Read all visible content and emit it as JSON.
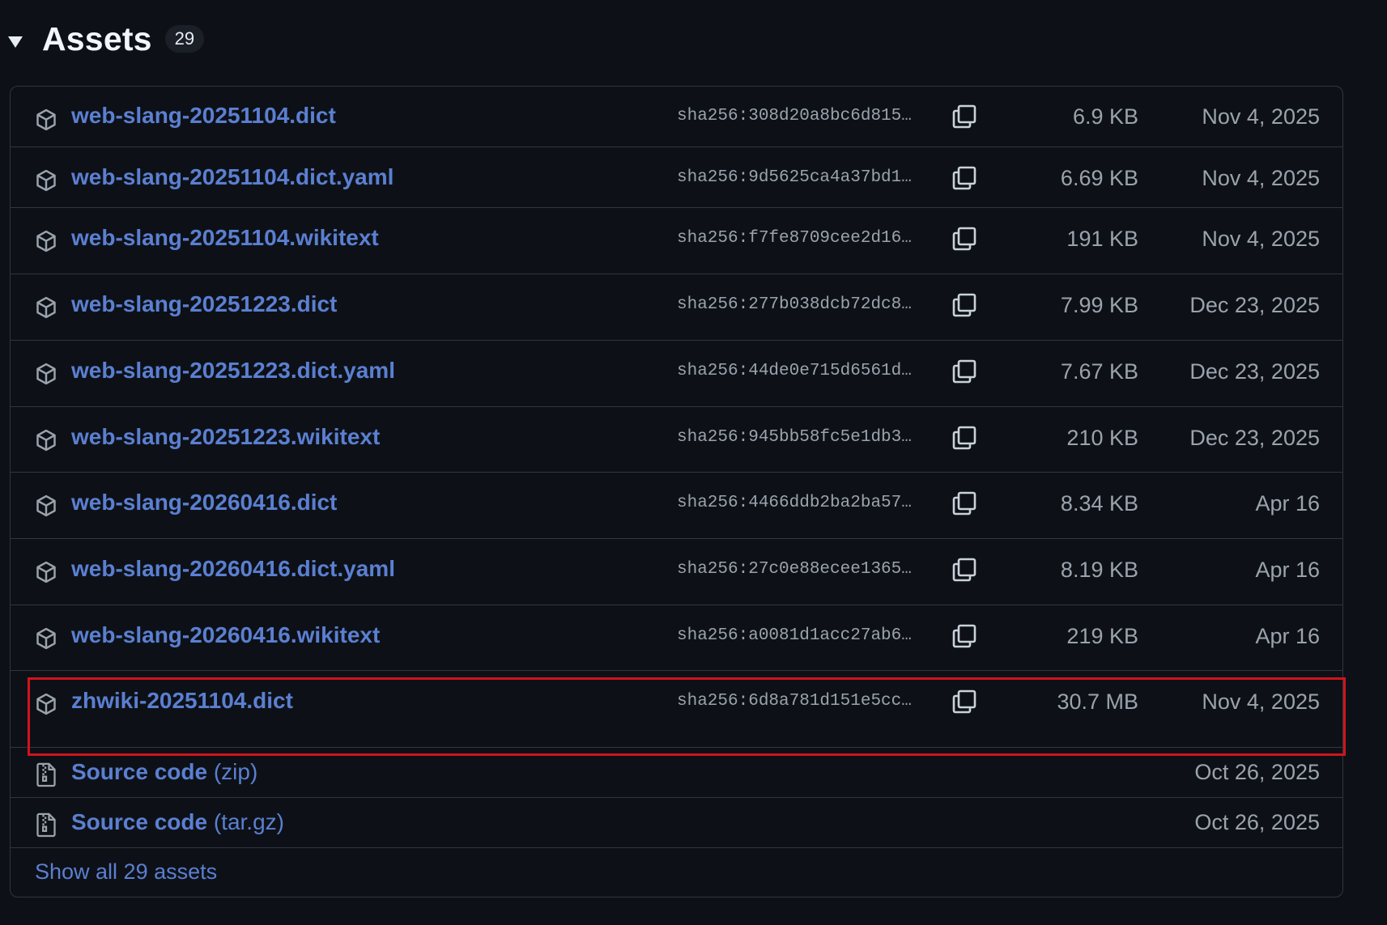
{
  "header": {
    "title": "Assets",
    "count": "29"
  },
  "assets": [
    {
      "name": "web-slang-20251104.dict",
      "sha": "sha256:308d20a8bc6d815…",
      "size": "6.9 KB",
      "date": "Nov 4, 2025"
    },
    {
      "name": "web-slang-20251104.dict.yaml",
      "sha": "sha256:9d5625ca4a37bd1…",
      "size": "6.69 KB",
      "date": "Nov 4, 2025"
    },
    {
      "name": "web-slang-20251104.wikitext",
      "sha": "sha256:f7fe8709cee2d16…",
      "size": "191 KB",
      "date": "Nov 4, 2025"
    },
    {
      "name": "web-slang-20251223.dict",
      "sha": "sha256:277b038dcb72dc8…",
      "size": "7.99 KB",
      "date": "Dec 23, 2025"
    },
    {
      "name": "web-slang-20251223.dict.yaml",
      "sha": "sha256:44de0e715d6561d…",
      "size": "7.67 KB",
      "date": "Dec 23, 2025"
    },
    {
      "name": "web-slang-20251223.wikitext",
      "sha": "sha256:945bb58fc5e1db3…",
      "size": "210 KB",
      "date": "Dec 23, 2025"
    },
    {
      "name": "web-slang-20260416.dict",
      "sha": "sha256:4466ddb2ba2ba57…",
      "size": "8.34 KB",
      "date": "Apr 16"
    },
    {
      "name": "web-slang-20260416.dict.yaml",
      "sha": "sha256:27c0e88ecee1365…",
      "size": "8.19 KB",
      "date": "Apr 16"
    },
    {
      "name": "web-slang-20260416.wikitext",
      "sha": "sha256:a0081d1acc27ab6…",
      "size": "219 KB",
      "date": "Apr 16"
    },
    {
      "name": "zhwiki-20251104.dict",
      "sha": "sha256:6d8a781d151e5cc…",
      "size": "30.7 MB",
      "date": "Nov 4, 2025"
    }
  ],
  "source_code": [
    {
      "label": "Source code",
      "ext": "(zip)",
      "date": "Oct 26, 2025"
    },
    {
      "label": "Source code",
      "ext": "(tar.gz)",
      "date": "Oct 26, 2025"
    }
  ],
  "show_all": "Show all 29 assets",
  "highlight_color": "#d0141c",
  "icons": {
    "asset": "package-icon",
    "copy": "copy-icon",
    "source": "file-zip-icon",
    "caret": "caret-down-icon"
  }
}
